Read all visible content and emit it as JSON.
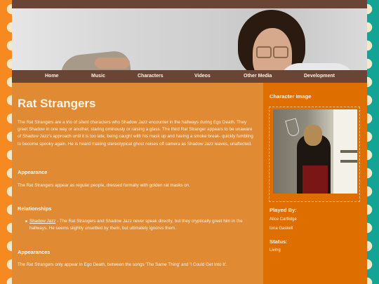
{
  "nav": {
    "home": "Home",
    "music": "Music",
    "characters": "Characters",
    "videos": "Videos",
    "other_media": "Other Media",
    "development": "Development"
  },
  "page": {
    "title": "Rat Strangers",
    "intro": "The Rat Strangers are a trio of silent characters who Shadow Jazz encounter in the hallways during Ego Death. They greet Shadow in one way or another, staring ominously or raising a glass. The third Rat Stranger appears to be unaware of Shadow Jazz's approach until it is too late, being caught with his mask up and having a smoke break- quickly fumbling to become spooky again. He is heard making stereotypical ghost noises off camera as Shadow Jazz leaves, unaffected.",
    "appearance": {
      "heading": "Appearance",
      "text": "The Rat Strangers appear as regular people, dressed formally with golden rat masks on."
    },
    "relationships": {
      "heading": "Relationships",
      "items": [
        {
          "link": "Shadow Jazz",
          "text": " - The Rat Strangers and Shadow Jazz never speak directly, but they cryptically greet him in the hallways. He seems slightly unsettled by them, but ultimately ignores them."
        }
      ]
    },
    "appearances": {
      "heading": "Appearances",
      "text": "The Rat Strangers only appear in Ego Death, between the songs 'The Same Thing' and 'I Could Get Into It'."
    }
  },
  "sidebar": {
    "image_heading": "Character Image",
    "played_by_heading": "Played By:",
    "played_by": [
      "Alice Cartlidge",
      "Iona Gaskell"
    ],
    "status_heading": "Status:",
    "status": "Living"
  },
  "colors": {
    "nav_bar": "#6a4535",
    "content_bg": "#e08a33",
    "sidebar_bg": "#de6e00",
    "border_left": "#f68a21",
    "border_right": "#13a496"
  }
}
